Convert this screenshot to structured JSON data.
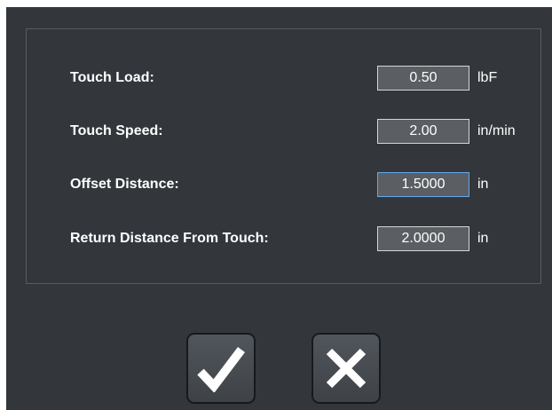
{
  "settings": {
    "rows": [
      {
        "label": "Touch Load:",
        "value": "0.50",
        "unit": "lbF"
      },
      {
        "label": "Touch Speed:",
        "value": "2.00",
        "unit": "in/min"
      },
      {
        "label": "Offset Distance:",
        "value": "1.5000",
        "unit": "in",
        "focused": true
      },
      {
        "label": "Return Distance From Touch:",
        "value": "2.0000",
        "unit": "in"
      }
    ]
  },
  "buttons": {
    "ok_icon": "checkmark-icon",
    "cancel_icon": "x-icon"
  },
  "colors": {
    "dialog_background": "#33373c",
    "input_background": "#5b5e63",
    "focus_border": "#62a8f0",
    "text": "#ffffff"
  }
}
